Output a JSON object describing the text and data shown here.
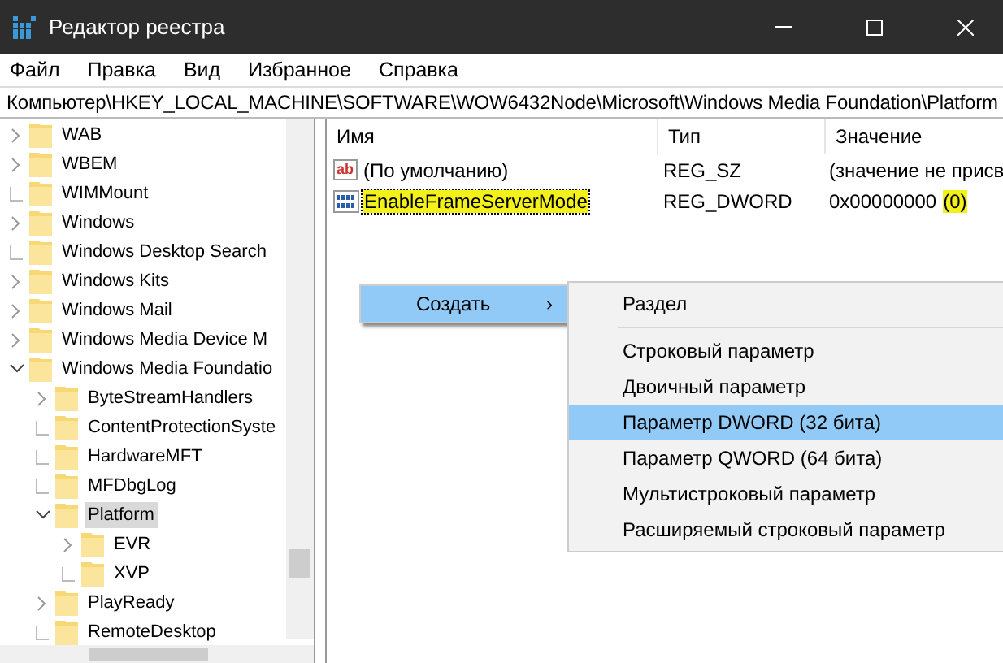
{
  "window": {
    "title": "Редактор реестра"
  },
  "menu": [
    "Файл",
    "Правка",
    "Вид",
    "Избранное",
    "Справка"
  ],
  "address": "Компьютер\\HKEY_LOCAL_MACHINE\\SOFTWARE\\WOW6432Node\\Microsoft\\Windows Media Foundation\\Platform",
  "tree": [
    {
      "label": "WAB",
      "kind": "collapsed",
      "selected": false,
      "highlighted": false
    },
    {
      "label": "WBEM",
      "kind": "collapsed",
      "selected": false,
      "highlighted": false
    },
    {
      "label": "WIMMount",
      "kind": "leaf",
      "selected": false,
      "highlighted": false
    },
    {
      "label": "Windows",
      "kind": "collapsed",
      "selected": false,
      "highlighted": false
    },
    {
      "label": "Windows Desktop Search",
      "kind": "leaf",
      "selected": false,
      "highlighted": false
    },
    {
      "label": "Windows Kits",
      "kind": "collapsed",
      "selected": false,
      "highlighted": false
    },
    {
      "label": "Windows Mail",
      "kind": "collapsed",
      "selected": false,
      "highlighted": false
    },
    {
      "label": "Windows Media Device M",
      "kind": "collapsed",
      "selected": false,
      "highlighted": false
    },
    {
      "label": "Windows Media Foundatio",
      "kind": "expanded",
      "selected": false,
      "highlighted": false,
      "children": [
        {
          "label": "ByteStreamHandlers",
          "kind": "collapsed",
          "selected": false,
          "highlighted": false
        },
        {
          "label": "ContentProtectionSyste",
          "kind": "leaf",
          "selected": false,
          "highlighted": false
        },
        {
          "label": "HardwareMFT",
          "kind": "leaf",
          "selected": false,
          "highlighted": false
        },
        {
          "label": "MFDbgLog",
          "kind": "leaf",
          "selected": false,
          "highlighted": false
        },
        {
          "label": "Platform",
          "kind": "expanded",
          "selected": true,
          "highlighted": true,
          "children": [
            {
              "label": "EVR",
              "kind": "collapsed",
              "selected": false,
              "highlighted": false
            },
            {
              "label": "XVP",
              "kind": "leaf",
              "selected": false,
              "highlighted": false
            }
          ]
        },
        {
          "label": "PlayReady",
          "kind": "collapsed",
          "selected": false,
          "highlighted": false
        },
        {
          "label": "RemoteDesktop",
          "kind": "leaf",
          "selected": false,
          "highlighted": false
        }
      ]
    }
  ],
  "table": {
    "columns": [
      "Имя",
      "Тип",
      "Значение"
    ],
    "rows": [
      {
        "kind": "string",
        "icon_text": "ab",
        "name": "(По умолчанию)",
        "type": "REG_SZ",
        "value": "(значение не присв",
        "name_highlighted": false,
        "focused": false
      },
      {
        "kind": "dword",
        "name": "EnableFrameServerMode",
        "type": "REG_DWORD",
        "value": "0x00000000",
        "value_note": "(0)",
        "name_highlighted": true,
        "note_highlighted": true,
        "focused": true
      }
    ]
  },
  "context_menu": {
    "items": [
      {
        "label": "Создать",
        "arrow": "›",
        "selected": true
      }
    ]
  },
  "submenu": {
    "items": [
      {
        "label": "Раздел",
        "selected": false,
        "separator_after": true
      },
      {
        "label": "Строковый параметр",
        "selected": false,
        "separator_after": false
      },
      {
        "label": "Двоичный параметр",
        "selected": false,
        "separator_after": false
      },
      {
        "label": "Параметр DWORD (32 бита)",
        "selected": true,
        "separator_after": false
      },
      {
        "label": "Параметр QWORD (64 бита)",
        "selected": false,
        "separator_after": false
      },
      {
        "label": "Мультистроковый параметр",
        "selected": false,
        "separator_after": false
      },
      {
        "label": "Расширяемый строковый параметр",
        "selected": false,
        "separator_after": false
      }
    ]
  }
}
